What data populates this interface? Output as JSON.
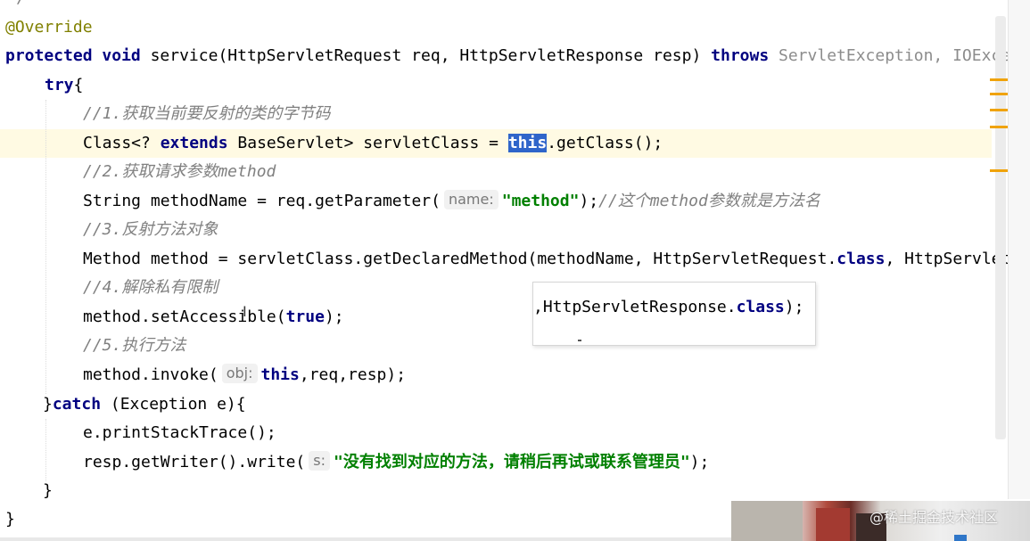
{
  "editor": {
    "top_fragment": "*/",
    "line_override": "@Override",
    "sig_protected": "protected",
    "sig_void": "void",
    "sig_method": " service(HttpServletRequest req, HttpServletResponse resp) ",
    "sig_throws": "throws",
    "sig_exceptions": " ServletException, IOExce",
    "try_kw": "try",
    "try_brace": "{",
    "comment1": "//1.获取当前要反射的类的字节码",
    "l_class_a": "Class<? ",
    "l_class_extends": "extends",
    "l_class_b": " BaseServlet> servletClass = ",
    "l_class_this": "this",
    "l_class_c": ".getClass();",
    "comment2": "//2.获取请求参数method",
    "l_string_a": "String methodName = req.getParameter(",
    "hint_name": "name:",
    "str_method": "\"method\"",
    "l_string_c": ");",
    "comment_inline": "//这个method参数就是方法名",
    "comment3": "//3.反射方法对象",
    "l_method_a": "Method method = servletClass.getDeclaredMethod(methodName, HttpServletRequest.",
    "kw_class1": "class",
    "l_method_b": ", HttpServlet",
    "comment4": "//4.解除私有限制",
    "l_access_a": "method.setAccessible(",
    "kw_true": "true",
    "l_access_b": ");",
    "comment5": "//5.执行方法",
    "l_invoke_a": "method.invoke(",
    "hint_obj": "obj:",
    "kw_this2": "this",
    "l_invoke_b": ",req,resp);",
    "catch_close": "}",
    "catch_kw": "catch",
    "catch_rest": " (Exception e){",
    "l_print": "e.printStackTrace();",
    "l_write_a": "resp.getWriter().write(",
    "hint_s": "s:",
    "str_msg": "\"没有找到对应的方法，请稍后再试或联系管理员\"",
    "l_write_b": ");",
    "close_inner": "}",
    "close_outer": "}"
  },
  "popup": {
    "text_a": ",HttpServletResponse.",
    "kw_class": "class",
    "text_b": ");"
  },
  "watermark": "@稀土掘金技术社区",
  "colors": {
    "keyword": "#000080",
    "annotation": "#808000",
    "comment": "#808080",
    "string": "#008000",
    "selection": "#2f65ca",
    "caret_line": "#fffae3",
    "marker": "#f0a30a"
  }
}
